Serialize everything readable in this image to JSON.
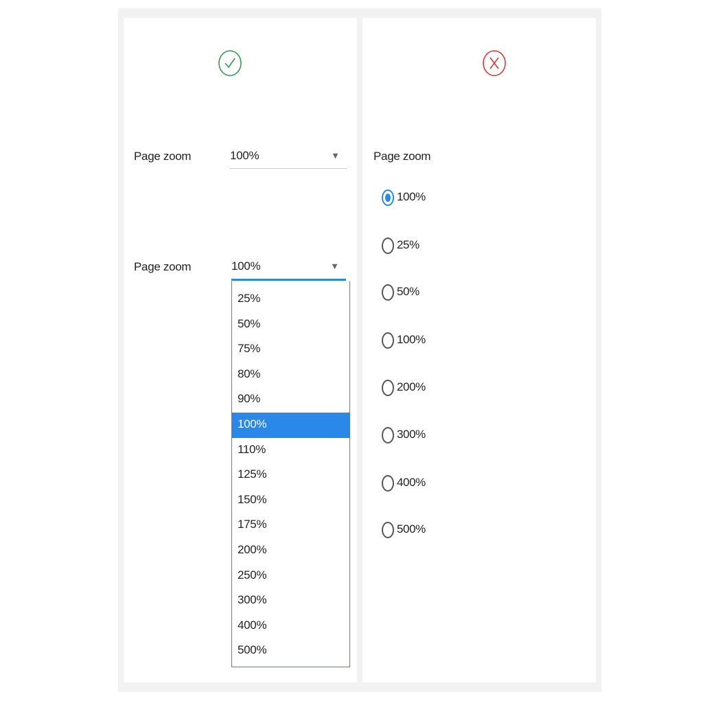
{
  "colors": {
    "accent": "#2a88e8",
    "ok": "#2e9e4f",
    "error": "#e03535",
    "background": "#f2f2f2"
  },
  "left_panel": {
    "status_icon": "check-circle-icon",
    "closed_select": {
      "label": "Page zoom",
      "value": "100%",
      "caret": "▼"
    },
    "open_select": {
      "label": "Page zoom",
      "value": "100%",
      "caret": "▼",
      "options": [
        "25%",
        "50%",
        "75%",
        "80%",
        "90%",
        "100%",
        "110%",
        "125%",
        "150%",
        "175%",
        "200%",
        "250%",
        "300%",
        "400%",
        "500%"
      ],
      "selected": "100%"
    }
  },
  "right_panel": {
    "status_icon": "x-circle-icon",
    "label": "Page zoom",
    "radios": [
      {
        "label": "100%",
        "checked": true
      },
      {
        "label": "25%",
        "checked": false
      },
      {
        "label": "50%",
        "checked": false
      },
      {
        "label": "100%",
        "checked": false
      },
      {
        "label": "200%",
        "checked": false
      },
      {
        "label": "300%",
        "checked": false
      },
      {
        "label": "400%",
        "checked": false
      },
      {
        "label": "500%",
        "checked": false
      }
    ]
  }
}
